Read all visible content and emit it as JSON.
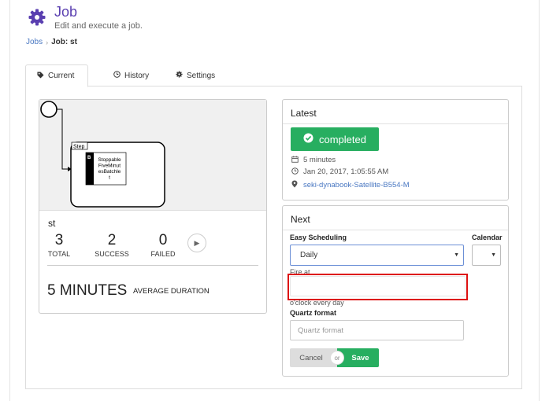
{
  "header": {
    "title": "Job",
    "subtitle": "Edit and execute a job.",
    "icon": "gear-icon",
    "accent_color": "#5a3fb0"
  },
  "breadcrumb": {
    "root": "Jobs",
    "current": "Job: st"
  },
  "tabs": [
    {
      "label": "Current",
      "icon": "tag-icon",
      "active": true
    },
    {
      "label": "History",
      "icon": "clock-icon",
      "active": false
    },
    {
      "label": "Settings",
      "icon": "gear-icon",
      "active": false
    }
  ],
  "diagram": {
    "step_label": "Step",
    "batchlet_marker": "B",
    "batchlet_lines": [
      "Stoppable",
      "FiveMinut",
      "esBatchle",
      "t"
    ]
  },
  "job": {
    "name": "st",
    "stats": {
      "total": {
        "value": "3",
        "label": "TOTAL"
      },
      "success": {
        "value": "2",
        "label": "SUCCESS"
      },
      "failed": {
        "value": "0",
        "label": "FAILED"
      }
    },
    "average_duration": {
      "value": "5 MINUTES",
      "label": "AVERAGE DURATION"
    }
  },
  "latest": {
    "title": "Latest",
    "status": "completed",
    "status_color": "#27ae60",
    "duration": "5 minutes",
    "timestamp": "Jan 20, 2017, 1:05:55 AM",
    "host": "seki-dynabook-Satellite-B554-M"
  },
  "next": {
    "title": "Next",
    "easy_scheduling_label": "Easy Scheduling",
    "easy_scheduling_value": "Daily",
    "calendar_label": "Calendar",
    "calendar_value": "",
    "fire_at_label": "Fire at",
    "fire_at_value": "",
    "oclock_text": "o'clock every day",
    "quartz_label": "Quartz format",
    "quartz_placeholder": "Quartz format",
    "cancel_label": "Cancel",
    "or_label": "or",
    "save_label": "Save"
  }
}
